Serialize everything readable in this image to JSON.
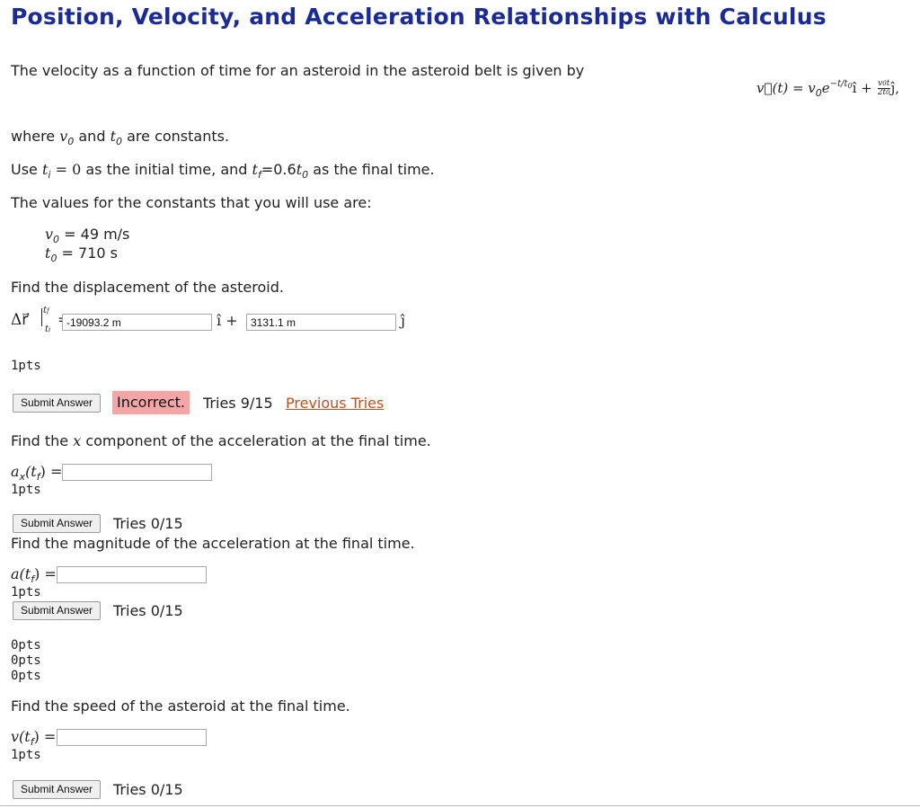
{
  "title": "Position, Velocity, and Acceleration Relationships with Calculus",
  "intro": "The velocity as a function of time for an asteroid in the asteroid belt is given by",
  "equation": {
    "lhs": "v⃗(t) = v",
    "sub0": "0",
    "exp_e": "e",
    "exponent": "−t/t",
    "exponent_sub": "0",
    "ihat": "î +",
    "frac_num": "v",
    "frac_num_sub": "0",
    "frac_num_t": "t",
    "frac_den": "2t",
    "frac_den_sub": "0",
    "jhat_tail": "ĵ,"
  },
  "line_where": {
    "prefix": "where",
    "v": "v",
    "v_sub": "0",
    "and": "and",
    "t": "t",
    "t_sub": "0",
    "suffix": "are constants."
  },
  "line_use": {
    "prefix": "Use",
    "ti": "t",
    "ti_sub": "i",
    "eq0": "= 0",
    "mid": "as the initial time, and",
    "tf": "t",
    "tf_sub": "f",
    "eq": "=0.6",
    "t0": "t",
    "t0_sub": "0",
    "suffix": "as the final time."
  },
  "constants_intro": "The values for the constants that you will use are:",
  "constants": [
    {
      "sym": "v",
      "sub": "0",
      "value": "= 49 m/s"
    },
    {
      "sym": "t",
      "sub": "0",
      "value": "= 710 s"
    }
  ],
  "q1": {
    "prompt": "Find the displacement of the asteroid.",
    "label_delta": "Δr⃗",
    "label_sup": "t",
    "label_sup_sub": "f",
    "label_low": "t",
    "label_low_sub": "i",
    "label_eq": "=",
    "input_i": "-19093.2 m",
    "ihat": "î +",
    "input_j": "3131.1 m",
    "jhat": "ĵ",
    "pts": "1pts",
    "submit": "Submit Answer",
    "status": "Incorrect.",
    "tries": "Tries 9/15",
    "previous": "Previous Tries"
  },
  "q2": {
    "prompt_pre": "Find the",
    "prompt_x": "x",
    "prompt_post": "component of the acceleration at the final time.",
    "label": "a",
    "label_sub": "x",
    "label_arg": "(t",
    "label_arg_sub": "f",
    "label_end": ") =",
    "input": "",
    "pts": "1pts",
    "submit": "Submit Answer",
    "tries": "Tries 0/15"
  },
  "q3": {
    "prompt": "Find the magnitude of the acceleration at the final time.",
    "label": "a(t",
    "label_sub": "f",
    "label_end": ") =",
    "input": "",
    "pts": "1pts",
    "submit": "Submit Answer",
    "tries": "Tries 0/15"
  },
  "zero_pts": [
    "0pts",
    "0pts",
    "0pts"
  ],
  "q4": {
    "prompt": "Find the speed of the asteroid at the final time.",
    "label": "v(t",
    "label_sub": "f",
    "label_end": ") =",
    "input": "",
    "pts": "1pts",
    "submit": "Submit Answer",
    "tries": "Tries 0/15"
  },
  "colors": {
    "title": "#1b2b94",
    "incorrect_bg": "#f4a6a6",
    "link": "#c0501f"
  }
}
